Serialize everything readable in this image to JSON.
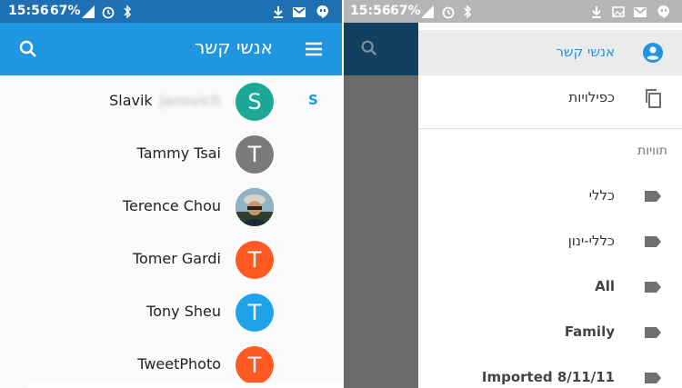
{
  "left": {
    "status": {
      "time": "15:56",
      "battery": "67%"
    },
    "app_title": "אנשי קשר",
    "section_letter": "S",
    "contacts": [
      {
        "name": "Slavik",
        "name_blurred": "Janovich",
        "initial": "S",
        "color": "#1ba895"
      },
      {
        "name": "Tammy Tsai",
        "initial": "T",
        "color": "#7a7a7a"
      },
      {
        "name": "Terence Chou",
        "initial": "",
        "photo": true
      },
      {
        "name": "Tomer Gardi",
        "initial": "T",
        "color": "#ff5a1f"
      },
      {
        "name": "Tony Sheu",
        "initial": "T",
        "color": "#1fa3e8"
      },
      {
        "name": "TweetPhoto",
        "initial": "T",
        "color": "#ff5a1f"
      }
    ]
  },
  "right": {
    "status": {
      "time": "15:56",
      "battery": "67%"
    },
    "drawer": {
      "contacts_label": "אנשי קשר",
      "duplicates_label": "כפילויות",
      "labels_header": "תוויות",
      "labels": [
        "כללי",
        "כללי-ינון",
        "All",
        "Family",
        "Imported 8/11/11"
      ]
    }
  },
  "colors": {
    "primary": "#2196e0",
    "status_bar": "#1f6fb3",
    "label_icon": "#707070"
  }
}
